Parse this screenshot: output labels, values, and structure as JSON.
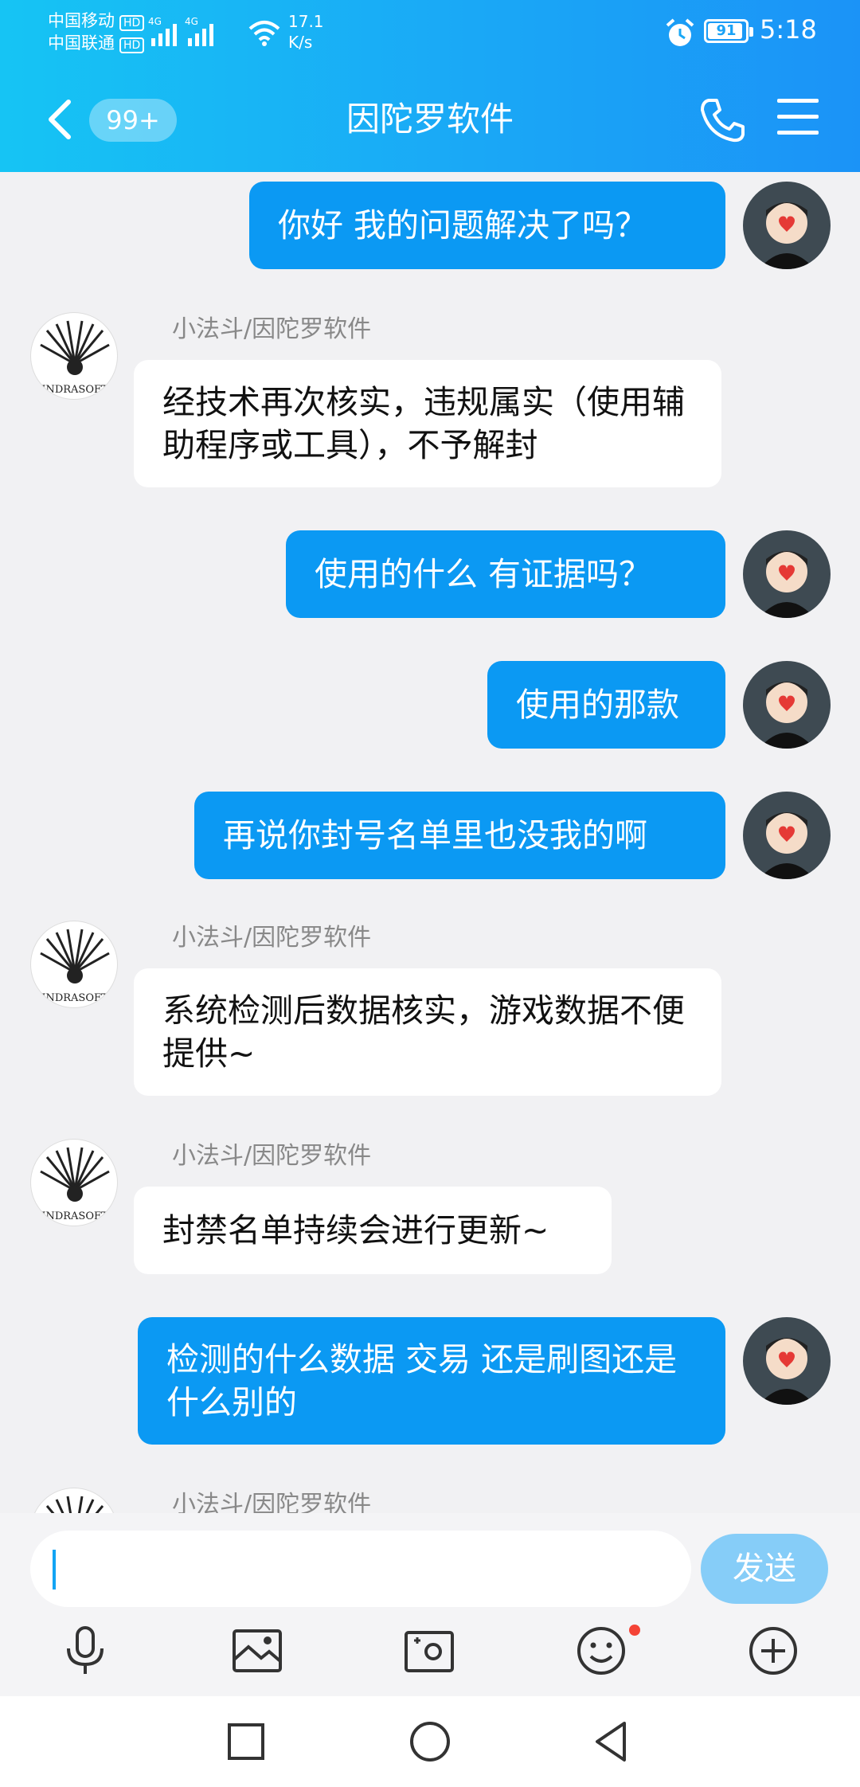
{
  "status_bar": {
    "carrier1": "中国移动",
    "carrier2": "中国联通",
    "hd_badge": "HD",
    "network1": "4G",
    "network2": "4G",
    "speed_value": "17.1",
    "speed_unit": "K/s",
    "battery": "91",
    "time": "5:18"
  },
  "header": {
    "unread_badge": "99+",
    "title": "因陀罗软件"
  },
  "messages": [
    {
      "side": "out",
      "text": "你好  我的问题解决了吗？"
    },
    {
      "side": "in",
      "sender": "小法斗/因陀罗软件",
      "text": "经技术再次核实，违规属实（使用辅助程序或工具），不予解封"
    },
    {
      "side": "out",
      "text": "使用的什么  有证据吗？"
    },
    {
      "side": "out",
      "text": "使用的那款"
    },
    {
      "side": "out",
      "text": "再说你封号名单里也没我的啊"
    },
    {
      "side": "in",
      "sender": "小法斗/因陀罗软件",
      "text": "系统检测后数据核实，游戏数据不便提供~"
    },
    {
      "side": "in",
      "sender": "小法斗/因陀罗软件",
      "text": "封禁名单持续会进行更新~"
    },
    {
      "side": "out",
      "text": "检测的什么数据  交易  还是刷图还是什么别的"
    },
    {
      "side": "in",
      "sender": "小法斗/因陀罗软件",
      "text": ""
    }
  ],
  "bot_avatar_label": "INDRASOFT",
  "input": {
    "value": "",
    "send_label": "发送"
  },
  "toolbar_icons": [
    "microphone-icon",
    "image-icon",
    "camera-icon",
    "emoji-icon",
    "plus-icon"
  ],
  "colors": {
    "header_start": "#16c4f4",
    "header_end": "#1b93f7",
    "outgoing_bubble": "#0b99f3",
    "incoming_bubble": "#ffffff",
    "send_button": "#86cdf8",
    "notification_dot": "#f44336"
  }
}
